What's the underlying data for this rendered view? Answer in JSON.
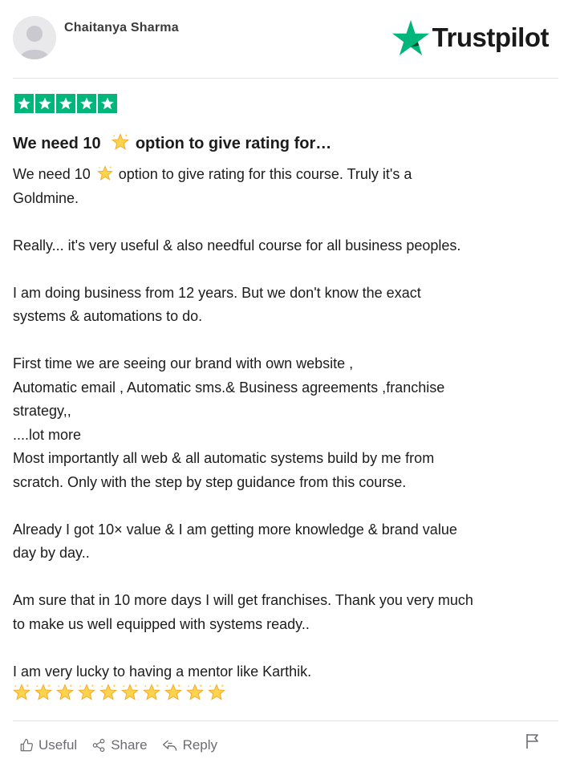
{
  "reviewer": {
    "name": "Chaitanya Sharma",
    "avatar_icon": "default-user-avatar-icon"
  },
  "brand": {
    "name": "Trustpilot",
    "star_color": "#00b67a",
    "star_icon": "star-icon"
  },
  "rating": {
    "value": 5,
    "max": 5,
    "color": "#00b67a"
  },
  "review": {
    "title_prefix": "We need 10",
    "title_suffix": " option to give rating for…",
    "lines": [
      {
        "prefix": "We need 10",
        "suffix": " option to give rating for this course. Truly it's a",
        "has_star": true
      },
      {
        "text": "Goldmine."
      },
      {
        "text": ""
      },
      {
        "text": "Really... it's very useful & also needful course for all business peoples."
      },
      {
        "text": ""
      },
      {
        "text": "I am doing business from 12 years. But we don't know the exact"
      },
      {
        "text": "systems & automations to do."
      },
      {
        "text": ""
      },
      {
        "text": "First time we are seeing our brand with own website ,"
      },
      {
        "text": "Automatic email , Automatic sms.& Business agreements ,franchise"
      },
      {
        "text": "strategy,,"
      },
      {
        "text": "....lot more"
      },
      {
        "text": "Most importantly all web & all automatic systems build by me from"
      },
      {
        "text": "scratch. Only with the step by step guidance from this course."
      },
      {
        "text": ""
      },
      {
        "text": "Already I got 10× value & I am getting more knowledge & brand value"
      },
      {
        "text": "day by day.."
      },
      {
        "text": ""
      },
      {
        "text": "Am sure that in 10 more days I will get franchises. Thank you very much"
      },
      {
        "text": "to make us well equipped with systems ready.."
      },
      {
        "text": ""
      },
      {
        "text": "I am very lucky to having a mentor like Karthik."
      }
    ],
    "emoji_star_count": 10,
    "emoji_icon": "glowing-star-emoji-icon"
  },
  "actions": {
    "useful_label": "Useful",
    "share_label": "Share",
    "reply_label": "Reply",
    "flag_icon": "flag-icon"
  }
}
